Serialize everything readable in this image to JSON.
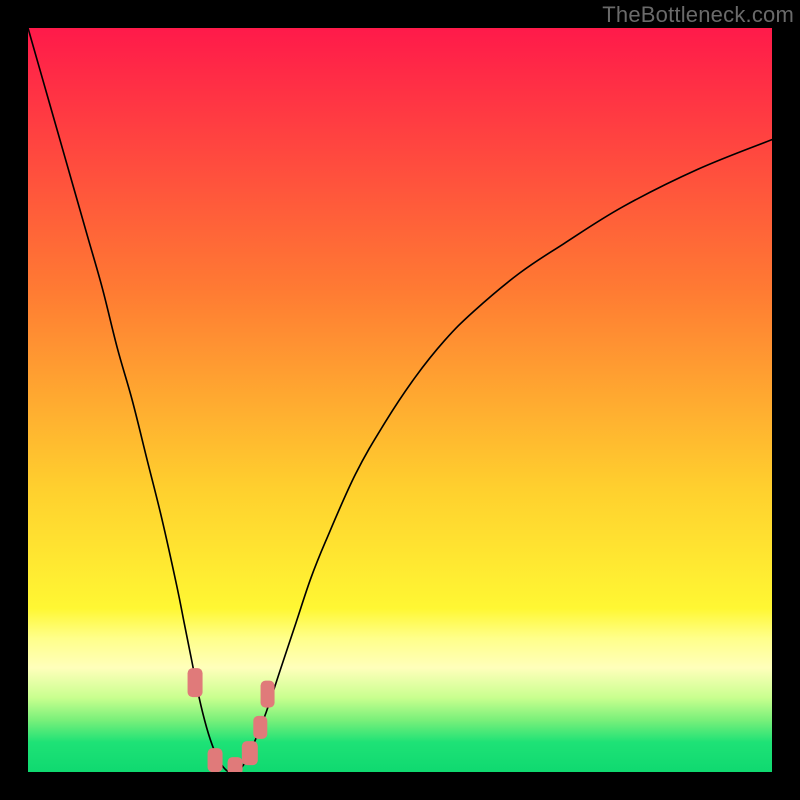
{
  "watermark": "TheBottleneck.com",
  "chart_data": {
    "type": "line",
    "title": "",
    "xlabel": "",
    "ylabel": "",
    "xlim": [
      0,
      100
    ],
    "ylim": [
      0,
      100
    ],
    "background_gradient_stops": [
      {
        "pct": 0,
        "color": "#ff1a4a"
      },
      {
        "pct": 35,
        "color": "#ff7a33"
      },
      {
        "pct": 62,
        "color": "#ffd02e"
      },
      {
        "pct": 78,
        "color": "#fff733"
      },
      {
        "pct": 82,
        "color": "#ffff8a"
      },
      {
        "pct": 86,
        "color": "#ffffbb"
      },
      {
        "pct": 90,
        "color": "#c9ff8f"
      },
      {
        "pct": 93,
        "color": "#7af07a"
      },
      {
        "pct": 96,
        "color": "#1ee276"
      },
      {
        "pct": 100,
        "color": "#0fd970"
      }
    ],
    "curve": {
      "x": [
        0,
        2,
        4,
        6,
        8,
        10,
        12,
        14,
        16,
        18,
        20,
        21,
        22,
        23,
        24,
        25,
        26,
        27,
        28,
        29,
        30,
        32,
        34,
        36,
        38,
        40,
        44,
        48,
        52,
        56,
        60,
        66,
        72,
        80,
        90,
        100
      ],
      "y": [
        100,
        93,
        86,
        79,
        72,
        65,
        57,
        50,
        42,
        34,
        25,
        20,
        15,
        10,
        6,
        3,
        1,
        0,
        0,
        1,
        3,
        8,
        14,
        20,
        26,
        31,
        40,
        47,
        53,
        58,
        62,
        67,
        71,
        76,
        81,
        85
      ]
    },
    "markers": [
      {
        "x": 22.5,
        "y": 12,
        "w": 2.0,
        "h": 4.0
      },
      {
        "x": 25.2,
        "y": 1.6,
        "w": 2.0,
        "h": 3.2
      },
      {
        "x": 27.8,
        "y": 0.8,
        "w": 2.0,
        "h": 2.4
      },
      {
        "x": 29.8,
        "y": 2.5,
        "w": 2.2,
        "h": 3.2
      },
      {
        "x": 31.2,
        "y": 6.0,
        "w": 1.8,
        "h": 3.0
      },
      {
        "x": 32.2,
        "y": 10.5,
        "w": 2.0,
        "h": 3.6
      }
    ]
  }
}
